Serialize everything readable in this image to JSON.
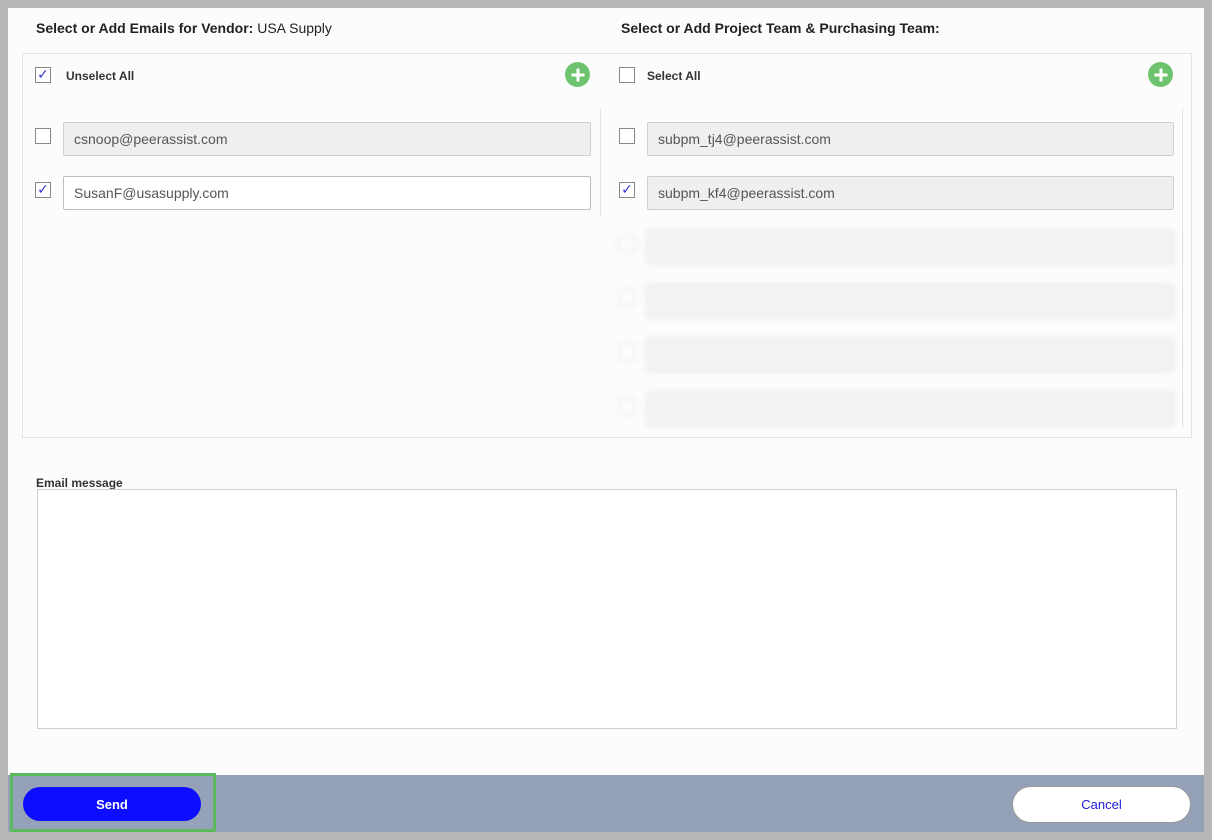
{
  "vendor_section": {
    "title_prefix": "Select or Add Emails for Vendor:",
    "vendor_name": "USA Supply",
    "select_all_label": "Unselect All",
    "select_all_checked": true,
    "emails": [
      {
        "value": "csnoop@peerassist.com",
        "checked": false,
        "editable": false
      },
      {
        "value": "SusanF@usasupply.com",
        "checked": true,
        "editable": true
      }
    ]
  },
  "team_section": {
    "title": "Select or Add Project Team & Purchasing Team:",
    "select_all_label": "Select All",
    "select_all_checked": false,
    "emails": [
      {
        "value": "subpm_tj4@peerassist.com",
        "checked": false
      },
      {
        "value": "subpm_kf4@peerassist.com",
        "checked": true
      }
    ]
  },
  "check_glyph": "✓",
  "email_message": {
    "label": "Email message",
    "value": ""
  },
  "footer": {
    "send_label": "Send",
    "cancel_label": "Cancel"
  },
  "colors": {
    "send_button": "#0d0dff",
    "add_button": "#6ec46e",
    "footer_bar": "#94a1b6",
    "highlight": "#5cb85c"
  }
}
